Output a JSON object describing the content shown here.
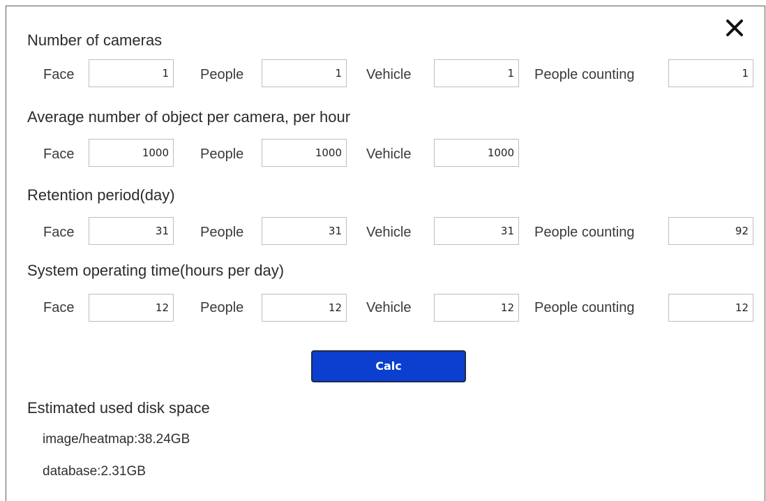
{
  "dialog": {
    "close_label": "✕"
  },
  "sections": [
    {
      "title": "Number of cameras",
      "fields": [
        {
          "label": "Face",
          "value": "1"
        },
        {
          "label": "People",
          "value": "1"
        },
        {
          "label": "Vehicle",
          "value": "1"
        },
        {
          "label": "People counting",
          "value": "1"
        }
      ]
    },
    {
      "title": "Average number of object per camera, per hour",
      "fields": [
        {
          "label": "Face",
          "value": "1000"
        },
        {
          "label": "People",
          "value": "1000"
        },
        {
          "label": "Vehicle",
          "value": "1000"
        }
      ]
    },
    {
      "title": "Retention period(day)",
      "fields": [
        {
          "label": "Face",
          "value": "31"
        },
        {
          "label": "People",
          "value": "31"
        },
        {
          "label": "Vehicle",
          "value": "31"
        },
        {
          "label": "People counting",
          "value": "92"
        }
      ]
    },
    {
      "title": "System operating time(hours per day)",
      "fields": [
        {
          "label": "Face",
          "value": "12"
        },
        {
          "label": "People",
          "value": "12"
        },
        {
          "label": "Vehicle",
          "value": "12"
        },
        {
          "label": "People counting",
          "value": "12"
        }
      ]
    }
  ],
  "calc_button": {
    "label": "Calc",
    "color": "#0b3fd0"
  },
  "result": {
    "title": "Estimated used disk space",
    "image_heatmap": "image/heatmap:38.24GB",
    "database": "database:2.31GB"
  }
}
